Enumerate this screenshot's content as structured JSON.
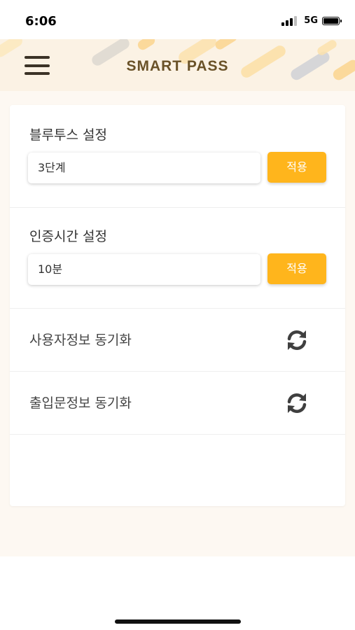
{
  "status_bar": {
    "time": "6:06",
    "network": "5G",
    "signal_icon": "signal-bars-icon",
    "battery_icon": "battery-icon"
  },
  "header": {
    "title": "SMART PASS",
    "menu_icon": "hamburger-menu-icon",
    "background_color": "#fbf2e4",
    "title_color": "#6a5228"
  },
  "settings": {
    "bluetooth": {
      "title": "블루투스 설정",
      "value": "3단계",
      "apply_label": "적용"
    },
    "auth_time": {
      "title": "인증시간 설정",
      "value": "10분",
      "apply_label": "적용"
    }
  },
  "sync": {
    "user_info": {
      "label": "사용자정보 동기화",
      "icon": "sync-icon"
    },
    "door_info": {
      "label": "출입문정보 동기화",
      "icon": "sync-icon"
    }
  },
  "colors": {
    "accent": "#ffb51c",
    "content_background": "#fdf8f2"
  }
}
